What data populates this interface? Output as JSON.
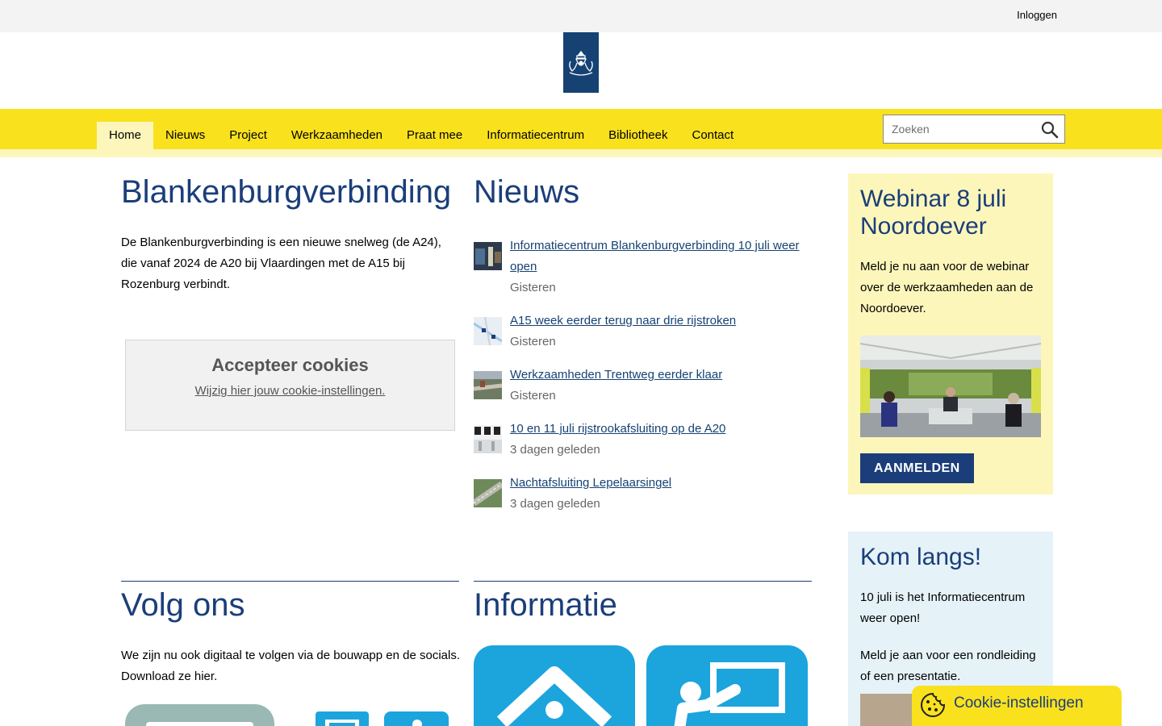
{
  "topbar": {
    "login_label": "Inloggen"
  },
  "nav": {
    "items": [
      {
        "label": "Home",
        "active": true
      },
      {
        "label": "Nieuws"
      },
      {
        "label": "Project"
      },
      {
        "label": "Werkzaamheden"
      },
      {
        "label": "Praat mee"
      },
      {
        "label": "Informatiecentrum"
      },
      {
        "label": "Bibliotheek"
      },
      {
        "label": "Contact"
      }
    ],
    "search_placeholder": "Zoeken"
  },
  "intro": {
    "title": "Blankenburgverbinding",
    "text": "De Blankenburgverbinding is een nieuwe snelweg (de A24), die vanaf 2024 de A20 bij Vlaardingen met de A15 bij Rozenburg verbindt."
  },
  "cookie_notice": {
    "title": "Accepteer cookies",
    "link": "Wijzig hier jouw cookie-instellingen."
  },
  "news": {
    "title": "Nieuws",
    "items": [
      {
        "title": "Informatiecentrum Blankenburgverbinding 10 juli weer open",
        "date": "Gisteren"
      },
      {
        "title": "A15 week eerder terug naar drie rijstroken",
        "date": "Gisteren"
      },
      {
        "title": "Werkzaamheden Trentweg eerder klaar",
        "date": "Gisteren"
      },
      {
        "title": "10 en 11 juli rijstrookafsluiting op de A20",
        "date": "3 dagen geleden"
      },
      {
        "title": "Nachtafsluiting Lepelaarsingel",
        "date": "3 dagen geleden"
      }
    ]
  },
  "webinar": {
    "title": "Webinar 8 juli Noordoever",
    "text": "Meld je nu aan voor de webinar over de werkzaamheden aan de Noordoever.",
    "button": "AANMELDEN"
  },
  "kom_langs": {
    "title": "Kom langs!",
    "text1": "10 juli is het Informatiecentrum weer open!",
    "text2": "Meld je aan voor een rondleiding of een presentatie."
  },
  "volg": {
    "title": "Volg ons",
    "text": "We zijn nu ook digitaal te volgen via de bouwapp en de socials. Download ze hier."
  },
  "informatie": {
    "title": "Informatie"
  },
  "cookie_fab": {
    "label": "Cookie-instellingen"
  },
  "colors": {
    "brand_blue": "#154273",
    "title_blue": "#1b3e7a",
    "nav_yellow": "#f9e11e",
    "light_yellow": "#fdf6bb",
    "light_blue": "#e5f2f8",
    "tile_blue": "#1ca4dd"
  }
}
